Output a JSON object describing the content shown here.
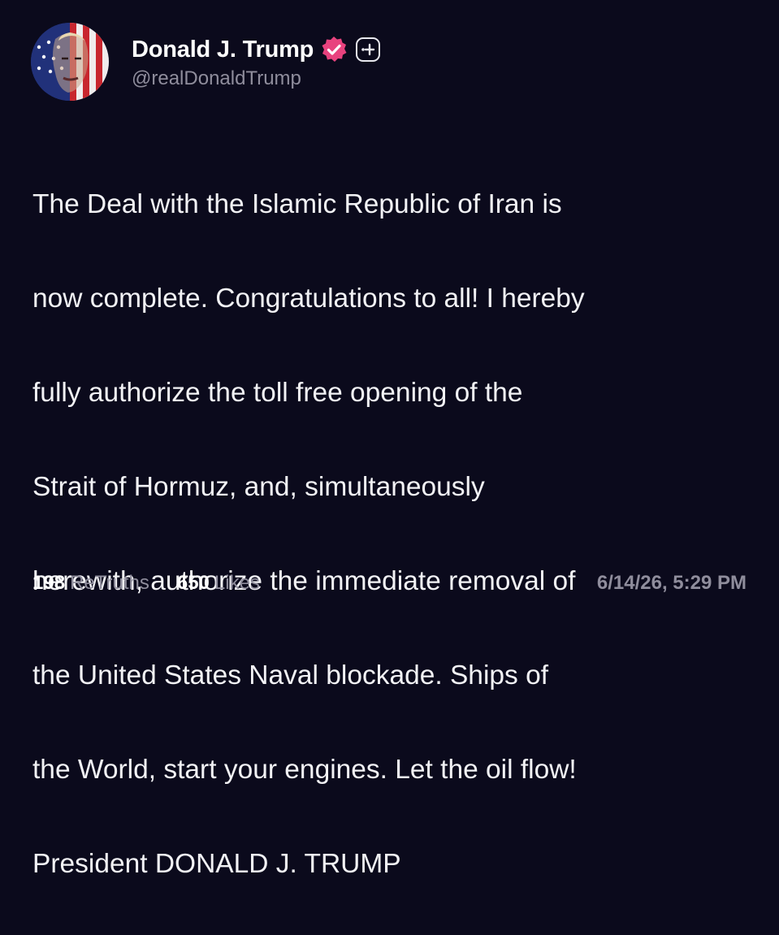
{
  "author": {
    "display_name": "Donald J. Trump",
    "handle": "@realDonaldTrump",
    "verified": true,
    "verified_color": "#e8427e"
  },
  "post": {
    "lines": [
      "The Deal with the Islamic Republic of Iran is",
      "now complete. Congratulations to all! I hereby",
      "fully authorize the toll free opening of the",
      "Strait of Hormuz, and, simultaneously",
      "herewith, authorize the immediate removal of",
      "the United States Naval blockade. Ships of",
      "the World, start your engines. Let the oil flow!",
      "President DONALD J. TRUMP"
    ]
  },
  "stats": {
    "retruths_count": "198",
    "retruths_label": "ReTruths",
    "likes_count": "650",
    "likes_label": "Likes"
  },
  "timestamp": "6/14/26, 5:29 PM",
  "colors": {
    "background": "#0b0a1c",
    "text": "#f2f2f5",
    "muted": "#8f8d9c"
  },
  "icons": {
    "verified": "verified-badge-icon",
    "follow": "plus-icon"
  }
}
